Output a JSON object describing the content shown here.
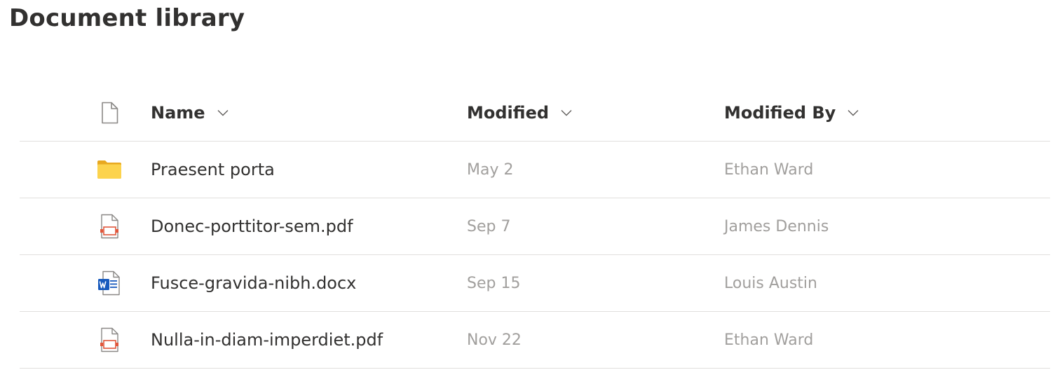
{
  "page": {
    "title": "Document library"
  },
  "columns": {
    "type_icon": "document-icon",
    "name": "Name",
    "modified": "Modified",
    "modified_by": "Modified By"
  },
  "rows": [
    {
      "type": "folder",
      "icon": "folder-icon",
      "name": "Praesent porta",
      "modified": "May 2",
      "modified_by": "Ethan Ward"
    },
    {
      "type": "pdf",
      "icon": "pdf-file-icon",
      "name": "Donec-porttitor-sem.pdf",
      "modified": "Sep 7",
      "modified_by": "James Dennis"
    },
    {
      "type": "docx",
      "icon": "word-file-icon",
      "name": "Fusce-gravida-nibh.docx",
      "modified": "Sep 15",
      "modified_by": "Louis Austin"
    },
    {
      "type": "pdf",
      "icon": "pdf-file-icon",
      "name": "Nulla-in-diam-imperdiet.pdf",
      "modified": "Nov 22",
      "modified_by": "Ethan Ward"
    }
  ],
  "colors": {
    "text_primary": "#323130",
    "text_secondary": "#a19f9d",
    "divider": "#e1dfdd",
    "folder": "#f8c84a",
    "pdf_accent": "#e0563b",
    "word_blue": "#185abd"
  }
}
